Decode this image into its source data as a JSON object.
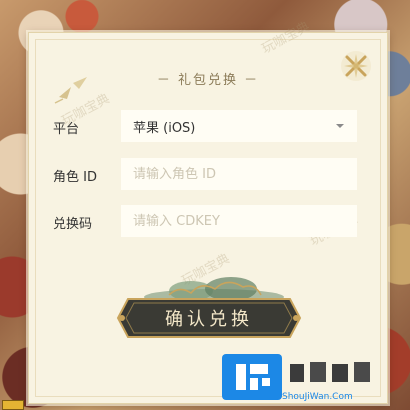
{
  "dialog": {
    "title": "－ 礼包兑换 －",
    "watermarks": [
      "玩咖宝典",
      "玩咖宝典",
      "玩咖宝典",
      "玩咖宝典"
    ]
  },
  "form": {
    "platform_label": "平台",
    "platform_value": "苹果 (iOS)",
    "role_label": "角色 ID",
    "role_placeholder": "请输入角色 ID",
    "code_label": "兑换码",
    "code_placeholder": "请输入 CDKEY"
  },
  "confirm_button": {
    "label": "确认兑换"
  },
  "site_logo": {
    "sub": "ShouJiWan.Com"
  },
  "colors": {
    "panel": "#f8f3e2",
    "button": "#3a3a34",
    "accent_gold": "#c9a45c",
    "logo_blue": "#1c88e6"
  },
  "icons": [
    "close-icon",
    "bird-icon",
    "chevron-down-icon",
    "cloud-icon"
  ]
}
